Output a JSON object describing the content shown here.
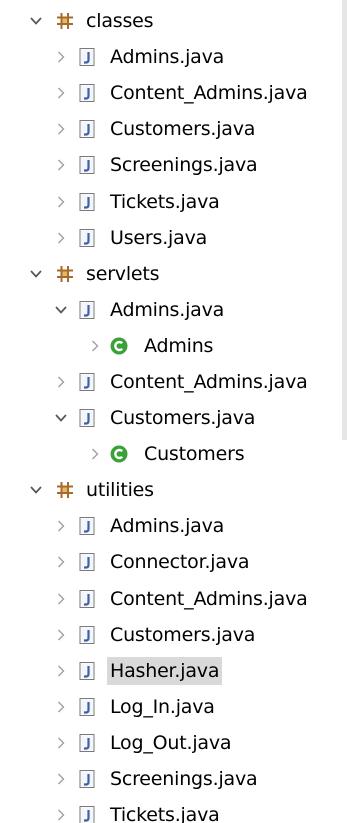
{
  "tree": [
    {
      "level": 0,
      "twisty": "expanded",
      "icon": "package",
      "label": "classes"
    },
    {
      "level": 1,
      "twisty": "collapsed",
      "icon": "java-file",
      "label": "Admins.java"
    },
    {
      "level": 1,
      "twisty": "collapsed",
      "icon": "java-file",
      "label": "Content_Admins.java"
    },
    {
      "level": 1,
      "twisty": "collapsed",
      "icon": "java-file",
      "label": "Customers.java"
    },
    {
      "level": 1,
      "twisty": "collapsed",
      "icon": "java-file",
      "label": "Screenings.java"
    },
    {
      "level": 1,
      "twisty": "collapsed",
      "icon": "java-file",
      "label": "Tickets.java"
    },
    {
      "level": 1,
      "twisty": "collapsed",
      "icon": "java-file",
      "label": "Users.java"
    },
    {
      "level": 0,
      "twisty": "expanded",
      "icon": "package",
      "label": "servlets"
    },
    {
      "level": 1,
      "twisty": "expanded",
      "icon": "java-file",
      "label": "Admins.java"
    },
    {
      "level": 2,
      "twisty": "collapsed",
      "icon": "class",
      "label": "Admins"
    },
    {
      "level": 1,
      "twisty": "collapsed",
      "icon": "java-file",
      "label": "Content_Admins.java"
    },
    {
      "level": 1,
      "twisty": "expanded",
      "icon": "java-file",
      "label": "Customers.java"
    },
    {
      "level": 2,
      "twisty": "collapsed",
      "icon": "class",
      "label": "Customers"
    },
    {
      "level": 0,
      "twisty": "expanded",
      "icon": "package",
      "label": "utilities"
    },
    {
      "level": 1,
      "twisty": "collapsed",
      "icon": "java-file",
      "label": "Admins.java"
    },
    {
      "level": 1,
      "twisty": "collapsed",
      "icon": "java-file",
      "label": "Connector.java"
    },
    {
      "level": 1,
      "twisty": "collapsed",
      "icon": "java-file",
      "label": "Content_Admins.java"
    },
    {
      "level": 1,
      "twisty": "collapsed",
      "icon": "java-file",
      "label": "Customers.java"
    },
    {
      "level": 1,
      "twisty": "collapsed",
      "icon": "java-file",
      "label": "Hasher.java",
      "selected": true
    },
    {
      "level": 1,
      "twisty": "collapsed",
      "icon": "java-file",
      "label": "Log_In.java"
    },
    {
      "level": 1,
      "twisty": "collapsed",
      "icon": "java-file",
      "label": "Log_Out.java"
    },
    {
      "level": 1,
      "twisty": "collapsed",
      "icon": "java-file",
      "label": "Screenings.java"
    },
    {
      "level": 1,
      "twisty": "collapsed",
      "icon": "java-file",
      "label": "Tickets.java"
    }
  ],
  "colors": {
    "selection_bg": "#d9d9d9",
    "package_icon": "#a86a2c",
    "class_icon": "#3aa038",
    "java_icon": "#3e62a8",
    "twisty": "#666666"
  }
}
